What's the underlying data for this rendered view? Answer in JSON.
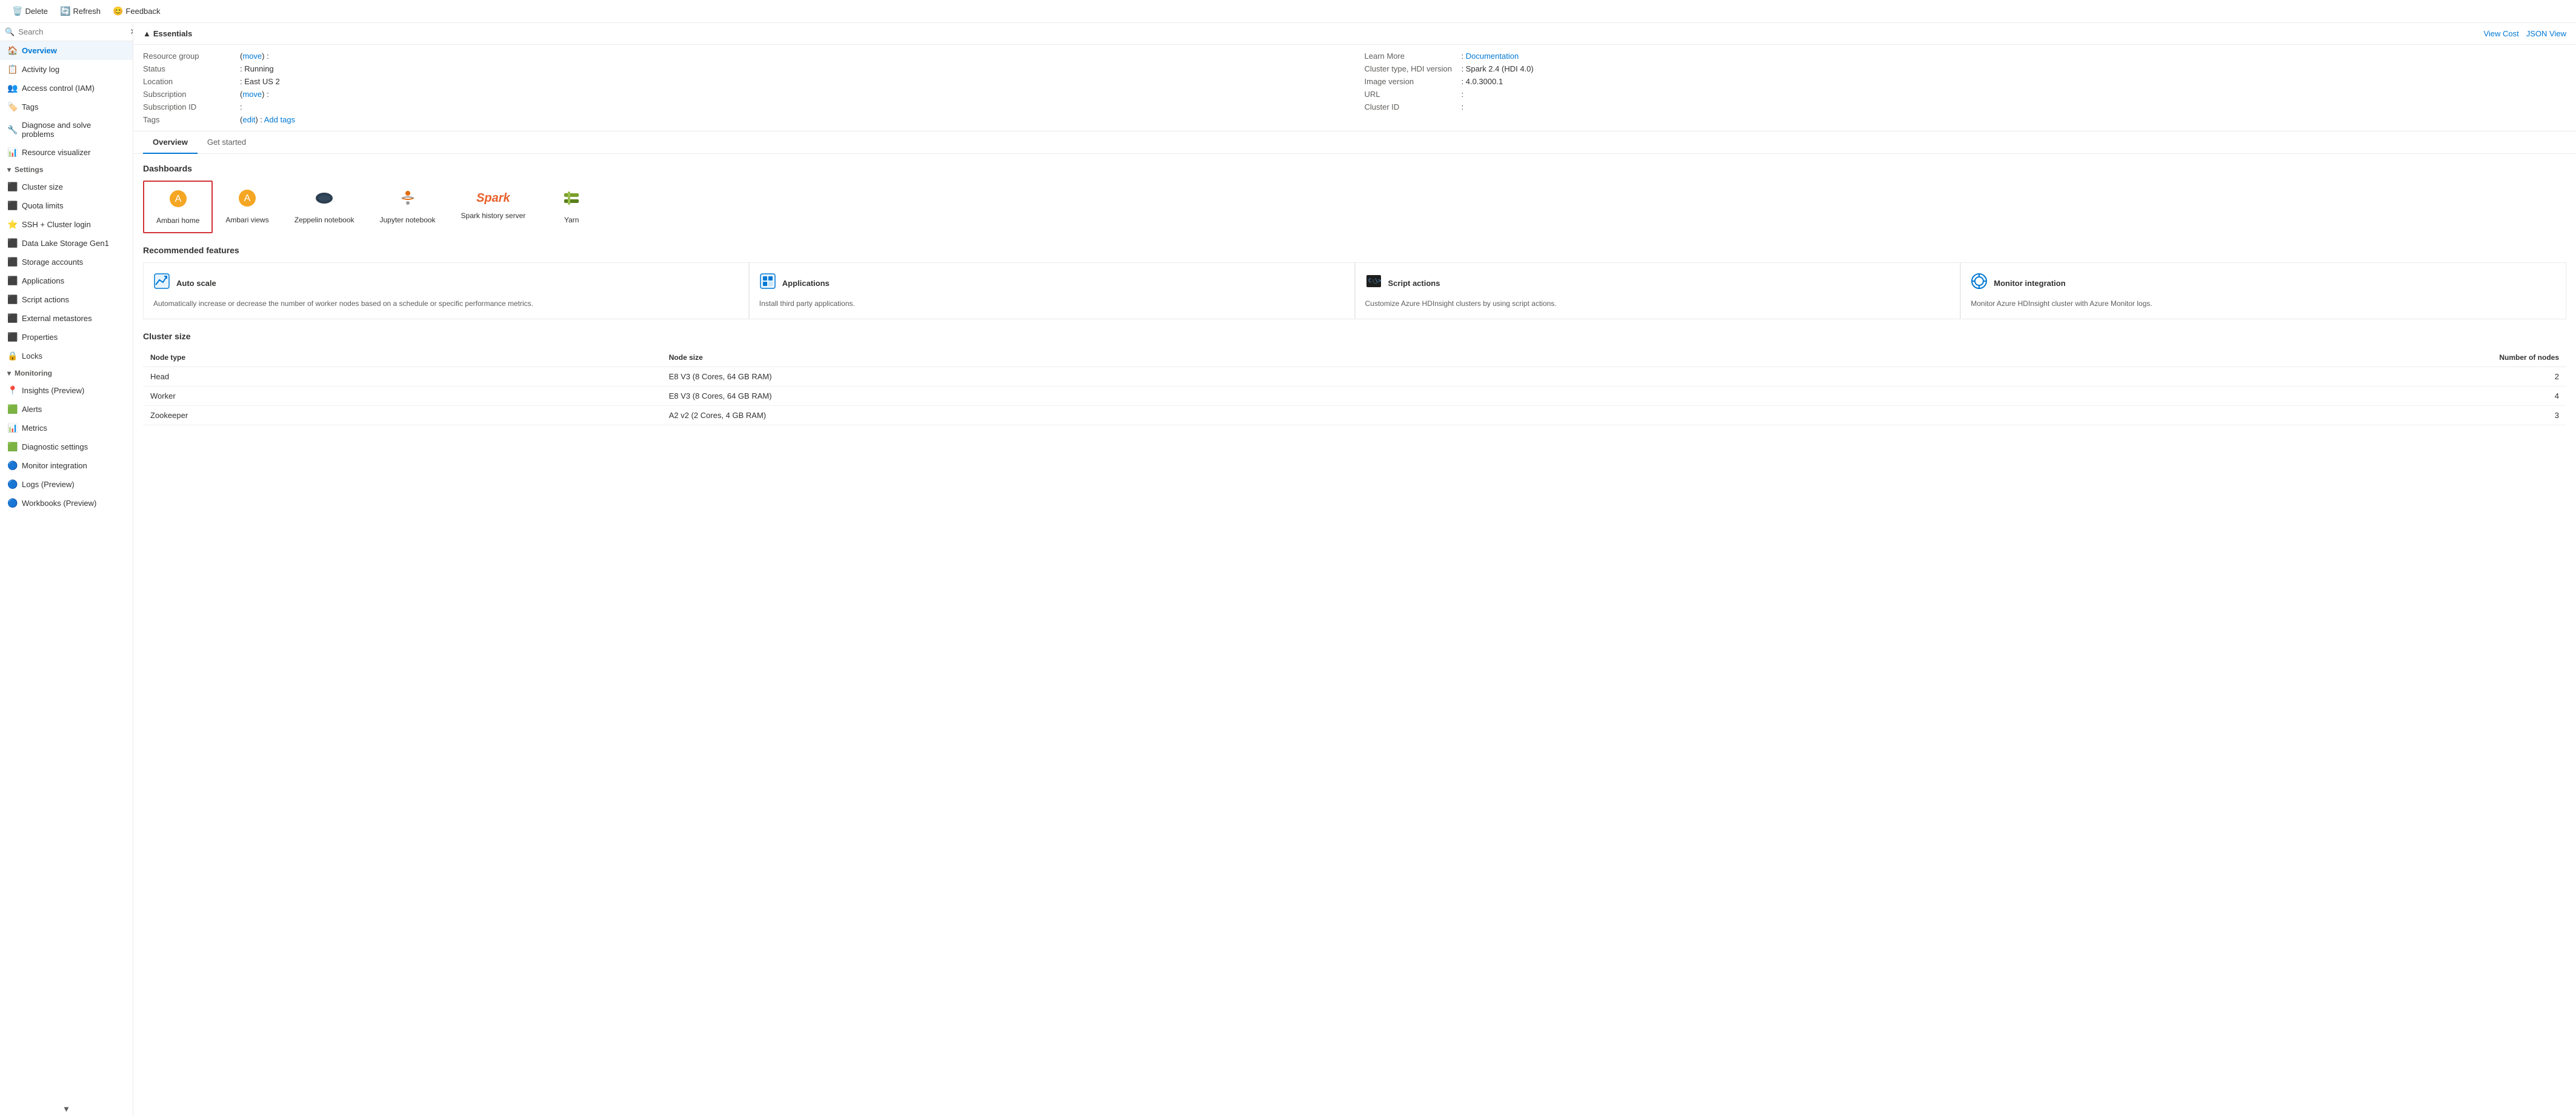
{
  "toolbar": {
    "delete_label": "Delete",
    "refresh_label": "Refresh",
    "feedback_label": "Feedback"
  },
  "sidebar": {
    "search_placeholder": "Search",
    "items": [
      {
        "id": "overview",
        "label": "Overview",
        "icon": "🏠",
        "active": true
      },
      {
        "id": "activity-log",
        "label": "Activity log",
        "icon": "📋"
      },
      {
        "id": "access-control",
        "label": "Access control (IAM)",
        "icon": "👥"
      },
      {
        "id": "tags",
        "label": "Tags",
        "icon": "🏷️"
      },
      {
        "id": "diagnose",
        "label": "Diagnose and solve problems",
        "icon": "🔧"
      },
      {
        "id": "resource-visualizer",
        "label": "Resource visualizer",
        "icon": "📊"
      }
    ],
    "settings_section": "Settings",
    "settings_items": [
      {
        "id": "cluster-size",
        "label": "Cluster size",
        "icon": "⬜"
      },
      {
        "id": "quota-limits",
        "label": "Quota limits",
        "icon": "⬜"
      },
      {
        "id": "ssh-login",
        "label": "SSH + Cluster login",
        "icon": "⭐"
      },
      {
        "id": "data-lake",
        "label": "Data Lake Storage Gen1",
        "icon": "⬜"
      },
      {
        "id": "storage-accounts",
        "label": "Storage accounts",
        "icon": "⬜"
      },
      {
        "id": "applications",
        "label": "Applications",
        "icon": "⬜"
      },
      {
        "id": "script-actions",
        "label": "Script actions",
        "icon": "⬜"
      },
      {
        "id": "external-metastores",
        "label": "External metastores",
        "icon": "⬜"
      },
      {
        "id": "properties",
        "label": "Properties",
        "icon": "⬜"
      },
      {
        "id": "locks",
        "label": "Locks",
        "icon": "🔒"
      }
    ],
    "monitoring_section": "Monitoring",
    "monitoring_items": [
      {
        "id": "insights",
        "label": "Insights (Preview)",
        "icon": "📍"
      },
      {
        "id": "alerts",
        "label": "Alerts",
        "icon": "🟩"
      },
      {
        "id": "metrics",
        "label": "Metrics",
        "icon": "📊"
      },
      {
        "id": "diagnostic-settings",
        "label": "Diagnostic settings",
        "icon": "🟩"
      },
      {
        "id": "monitor-integration",
        "label": "Monitor integration",
        "icon": "🔵"
      },
      {
        "id": "logs-preview",
        "label": "Logs (Preview)",
        "icon": "🔵"
      },
      {
        "id": "workbooks-preview",
        "label": "Workbooks (Preview)",
        "icon": "🔵"
      }
    ]
  },
  "essentials": {
    "title": "Essentials",
    "resource_group_label": "Resource group",
    "resource_group_link": "move",
    "status_label": "Status",
    "status_value": "Running",
    "location_label": "Location",
    "location_value": "East US 2",
    "subscription_label": "Subscription",
    "subscription_link": "move",
    "subscription_id_label": "Subscription ID",
    "tags_label": "Tags",
    "tags_edit_link": "edit",
    "tags_add_link": "Add tags",
    "learn_more_label": "Learn More",
    "documentation_link": "Documentation",
    "cluster_type_label": "Cluster type, HDI version",
    "cluster_type_value": "Spark 2.4 (HDI 4.0)",
    "image_version_label": "Image version",
    "image_version_value": "4.0.3000.1",
    "url_label": "URL",
    "cluster_id_label": "Cluster ID",
    "view_cost_label": "View Cost",
    "json_view_label": "JSON View"
  },
  "tabs": [
    {
      "id": "overview",
      "label": "Overview",
      "active": true
    },
    {
      "id": "get-started",
      "label": "Get started",
      "active": false
    }
  ],
  "dashboards": {
    "section_title": "Dashboards",
    "items": [
      {
        "id": "ambari-home",
        "label": "Ambari home",
        "selected": true
      },
      {
        "id": "ambari-views",
        "label": "Ambari views",
        "selected": false
      },
      {
        "id": "zeppelin-notebook",
        "label": "Zeppelin notebook",
        "selected": false
      },
      {
        "id": "jupyter-notebook",
        "label": "Jupyter notebook",
        "selected": false
      },
      {
        "id": "spark-history-server",
        "label": "Spark history server",
        "selected": false
      },
      {
        "id": "yarn",
        "label": "Yarn",
        "selected": false
      }
    ]
  },
  "recommended": {
    "section_title": "Recommended features",
    "items": [
      {
        "id": "auto-scale",
        "title": "Auto scale",
        "description": "Automatically increase or decrease the number of worker nodes based on a schedule or specific performance metrics.",
        "icon": "📈"
      },
      {
        "id": "applications",
        "title": "Applications",
        "description": "Install third party applications.",
        "icon": "📦"
      },
      {
        "id": "script-actions",
        "title": "Script actions",
        "description": "Customize Azure HDInsight clusters by using script actions.",
        "icon": "💻"
      },
      {
        "id": "monitor-integration",
        "title": "Monitor integration",
        "description": "Monitor Azure HDInsight cluster with Azure Monitor logs.",
        "icon": "🔵"
      }
    ]
  },
  "cluster_size": {
    "section_title": "Cluster size",
    "col_node_type": "Node type",
    "col_node_size": "Node size",
    "col_num_nodes": "Number of nodes",
    "rows": [
      {
        "node_type": "Head",
        "node_size": "E8 V3 (8 Cores, 64 GB RAM)",
        "num_nodes": "2"
      },
      {
        "node_type": "Worker",
        "node_size": "E8 V3 (8 Cores, 64 GB RAM)",
        "num_nodes": "4"
      },
      {
        "node_type": "Zookeeper",
        "node_size": "A2 v2 (2 Cores, 4 GB RAM)",
        "num_nodes": "3"
      }
    ]
  }
}
